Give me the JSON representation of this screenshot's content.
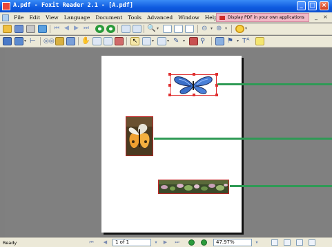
{
  "window": {
    "title": "A.pdf - Foxit Reader 2.1 - [A.pdf]",
    "controls": {
      "minimize": "_",
      "maximize": "□",
      "close": "×"
    }
  },
  "menu": {
    "items": [
      "File",
      "Edit",
      "View",
      "Language",
      "Document",
      "Tools",
      "Advanced",
      "Window",
      "Help"
    ],
    "promo": "Display PDF in your own applications",
    "doc_controls": [
      "_",
      "×"
    ]
  },
  "status": {
    "ready": "Ready",
    "page_indicator": "1 of 1",
    "zoom": "47.97%"
  },
  "colors": {
    "accent_line": "#2e9a55",
    "selection": "#d03030",
    "title_bar": "#0f5be0"
  },
  "images": [
    {
      "name": "butterfly-blue",
      "selected": true
    },
    {
      "name": "butterfly-orange",
      "selected": false
    },
    {
      "name": "flower-strip",
      "selected": false
    }
  ]
}
